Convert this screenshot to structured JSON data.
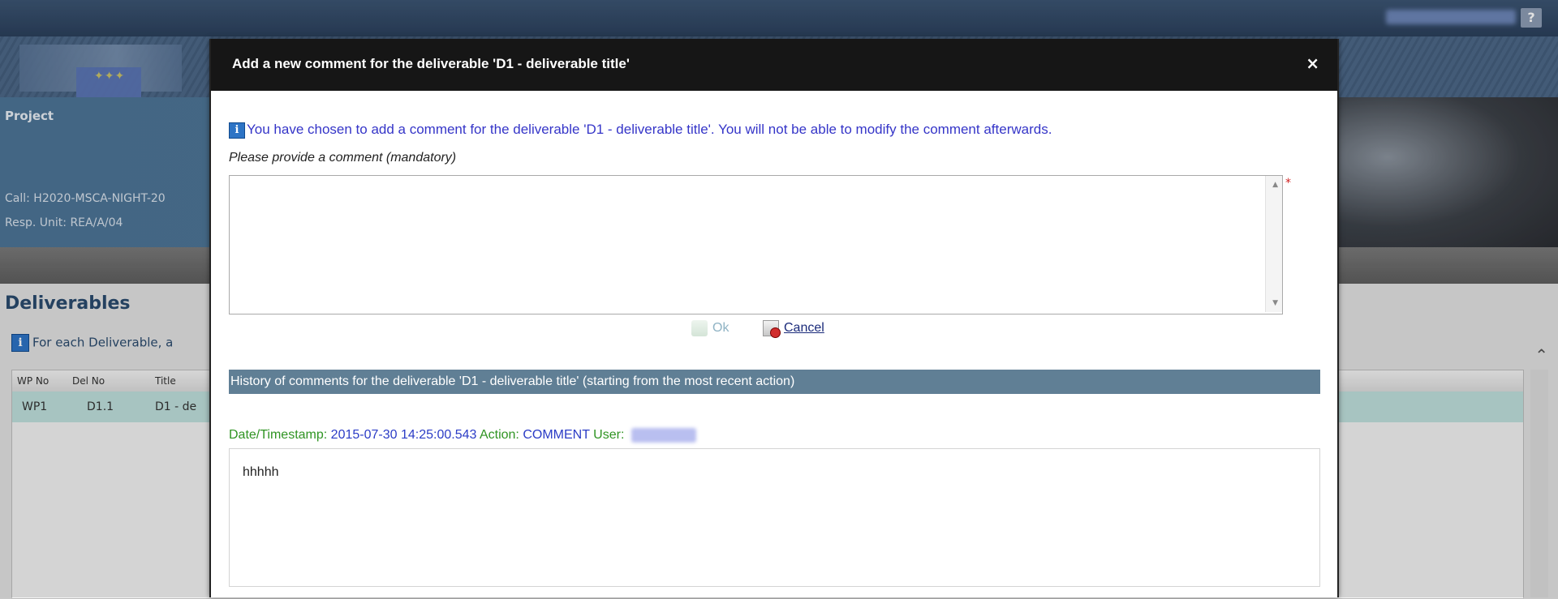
{
  "background": {
    "header": {
      "help_label": "?"
    },
    "project": {
      "project_label": "Project",
      "call_label": "Call: H2020-MSCA-NIGHT-20",
      "unit_label": "Resp. Unit: REA/A/04"
    },
    "deliverables": {
      "title": "Deliverables",
      "info_text": "For each Deliverable, a",
      "columns": [
        "WP No",
        "Del No",
        "Title"
      ],
      "rows": [
        {
          "wp_no": "WP1",
          "del_no": "D1.1",
          "title": "D1 - de"
        }
      ]
    }
  },
  "dialog": {
    "title": "Add a new comment for the deliverable 'D1 - deliverable title'",
    "close_label": "×",
    "notice": "You have chosen to add a comment for the deliverable 'D1 - deliverable title'. You will not be able to modify the comment afterwards.",
    "prompt": "Please provide a comment (mandatory)",
    "comment_value": "",
    "required_mark": "*",
    "ok_label": "Ok",
    "cancel_label": "Cancel",
    "history_header": "History of comments for the deliverable 'D1 - deliverable title' (starting from the most recent action)",
    "history": {
      "timestamp_key": "Date/Timestamp:",
      "timestamp": "2015-07-30 14:25:00.543",
      "action_key": "Action:",
      "action": "COMMENT",
      "user_key": "User:",
      "comment": "hhhhh"
    }
  },
  "colors": {
    "dialog_header": "#161616",
    "history_bar": "#607f95",
    "notice_text": "#3535c8",
    "meta_key": "#2f9422",
    "meta_value": "#2b3cc6"
  }
}
